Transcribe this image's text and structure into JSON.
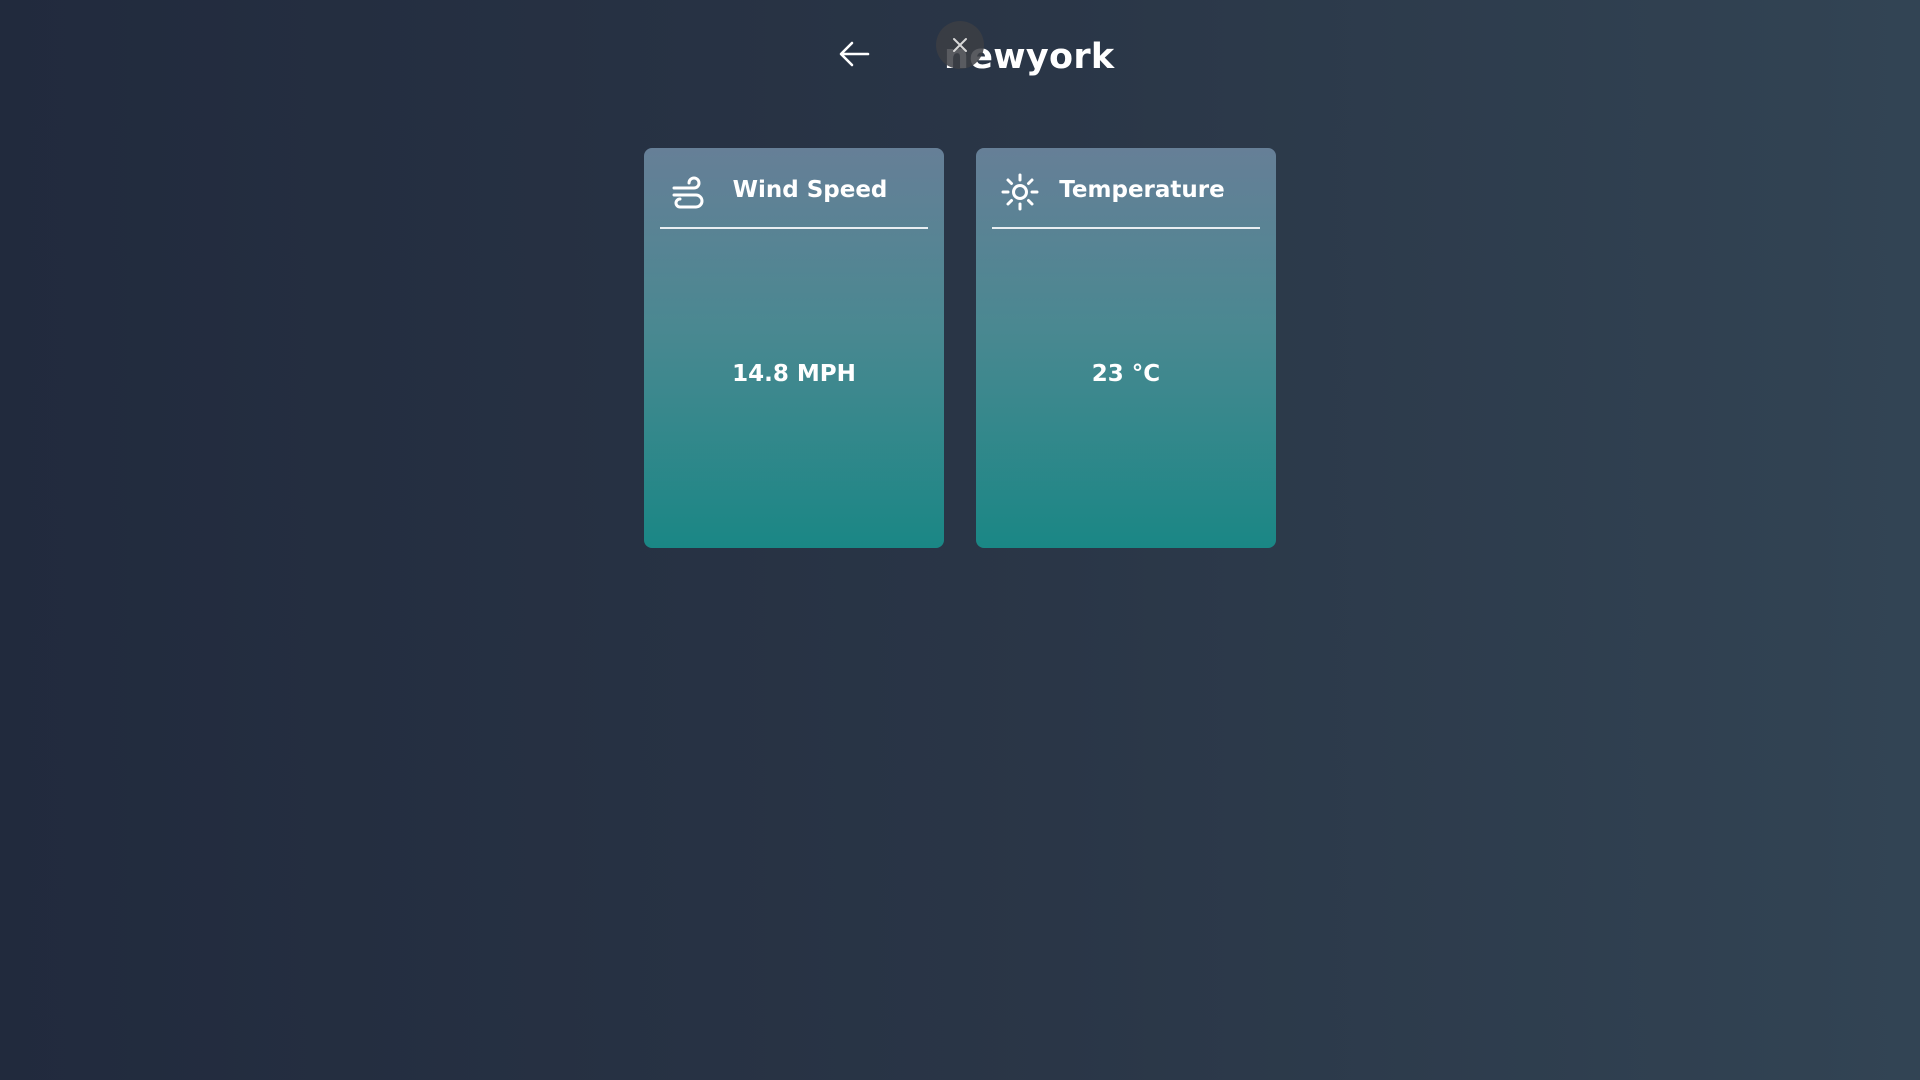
{
  "header": {
    "city": "newyork",
    "back_icon": "arrow-left-icon",
    "close_icon": "close-icon"
  },
  "cards": {
    "wind": {
      "title": "Wind Speed",
      "value": "14.8 MPH",
      "icon": "wind-icon"
    },
    "temperature": {
      "title": "Temperature",
      "value": "23 °C",
      "icon": "sun-icon"
    }
  },
  "colors": {
    "background_start": "#212a3d",
    "background_end": "#324454",
    "card_top": "#667f97",
    "card_bottom": "#1a8785",
    "text": "#ffffff"
  }
}
